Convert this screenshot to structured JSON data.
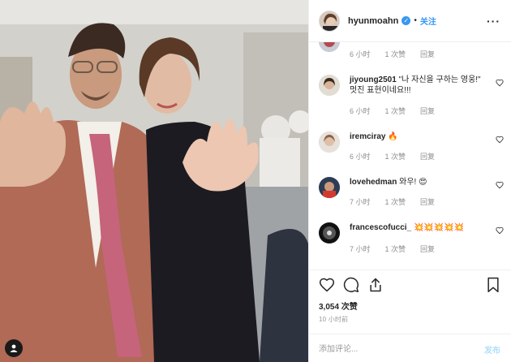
{
  "post": {
    "author": "hyunmoahn",
    "verified_icon": "verified-badge-icon",
    "dot": "•",
    "follow_label": "关注",
    "more_label": "···"
  },
  "comments": [
    {
      "username": "",
      "text": "",
      "time": "6 小时",
      "likes": "1 次赞",
      "reply": "回复"
    },
    {
      "username": "jiyoung2501",
      "text": "\"나 자신을 구하는 영웅!\" 멋진 표현이네요!!!",
      "time": "6 小时",
      "likes": "1 次赞",
      "reply": "回复"
    },
    {
      "username": "iremciray",
      "text": "🔥",
      "time": "6 小时",
      "likes": "1 次赞",
      "reply": "回复"
    },
    {
      "username": "lovehedman",
      "text": "와우! 😍",
      "time": "7 小时",
      "likes": "1 次赞",
      "reply": "回复"
    },
    {
      "username": "francescofucci_",
      "text": "💥💥💥💥💥",
      "time": "7 小时",
      "likes": "1 次赞",
      "reply": "回复"
    }
  ],
  "engagement": {
    "likes": "3,054 次赞",
    "posted": "10 小时前"
  },
  "add_comment": {
    "placeholder": "添加评论...",
    "post_label": "发布"
  },
  "colors": {
    "accent": "#3897f0",
    "post_disabled": "#b2dffc",
    "muted": "#8e8e8e"
  }
}
